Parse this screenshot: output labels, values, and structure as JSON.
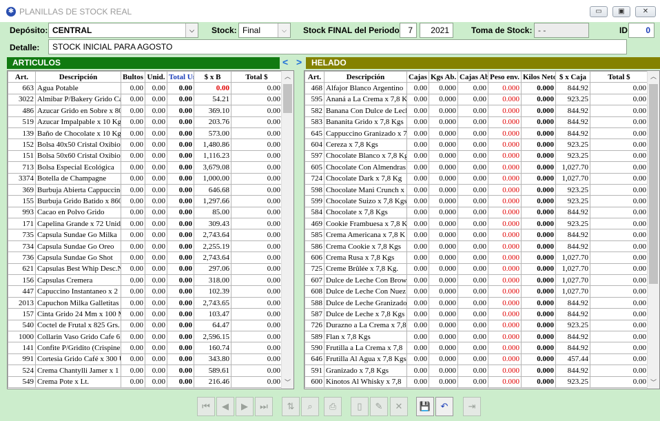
{
  "window": {
    "title": "PLANILLAS DE STOCK REAL"
  },
  "form": {
    "deposito_label": "Depósito:",
    "deposito_value": "CENTRAL",
    "stock_label": "Stock:",
    "stock_value": "Final",
    "periodo_label": "Stock FINAL del Periodo:",
    "month": "7",
    "year": "2021",
    "toma_label": "Toma de Stock:",
    "toma_value": "- -",
    "id_label": "ID",
    "id_value": "0",
    "detalle_label": "Detalle:",
    "detalle_value": "STOCK INICIAL PARA AGOSTO"
  },
  "sections": {
    "left": "ARTICULOS",
    "right": "HELADO",
    "arrow_left": "<",
    "arrow_right": ">"
  },
  "colors": {
    "section_left": "#117a11",
    "section_right": "#848200",
    "bg": "#ccedcc"
  },
  "left_table": {
    "headers": [
      "Art.",
      "Descripción",
      "Bultos",
      "Unid.",
      "Total Uni",
      "$ x B",
      "Total $"
    ],
    "rows": [
      [
        "663",
        "Agua Potable",
        "0.00",
        "0.00",
        "0.00",
        "0.00",
        "0.00"
      ],
      [
        "3022",
        "Almibar P/Bakery Grido Ca",
        "0.00",
        "0.00",
        "0.00",
        "54.21",
        "0.00"
      ],
      [
        "486",
        "Azucar Grido en Sobre x 80",
        "0.00",
        "0.00",
        "0.00",
        "369.10",
        "0.00"
      ],
      [
        "519",
        "Azucar Impalpable x 10 Kg",
        "0.00",
        "0.00",
        "0.00",
        "203.76",
        "0.00"
      ],
      [
        "139",
        "Baño de Chocolate x 10 Kg",
        "0.00",
        "0.00",
        "0.00",
        "573.00",
        "0.00"
      ],
      [
        "152",
        "Bolsa 40x50 Cristal Oxibio",
        "0.00",
        "0.00",
        "0.00",
        "1,480.86",
        "0.00"
      ],
      [
        "151",
        "Bolsa 50x60 Cristal Oxibio",
        "0.00",
        "0.00",
        "0.00",
        "1,116.23",
        "0.00"
      ],
      [
        "713",
        "Bolsa Especial Ecológica",
        "0.00",
        "0.00",
        "0.00",
        "3,679.08",
        "0.00"
      ],
      [
        "3374",
        "Botella de Champagne",
        "0.00",
        "0.00",
        "0.00",
        "1,000.00",
        "0.00"
      ],
      [
        "369",
        "Burbuja Abierta Cappuccino",
        "0.00",
        "0.00",
        "0.00",
        "646.68",
        "0.00"
      ],
      [
        "155",
        "Burbuja Grido Batido x 860",
        "0.00",
        "0.00",
        "0.00",
        "1,297.66",
        "0.00"
      ],
      [
        "993",
        "Cacao en Polvo Grido",
        "0.00",
        "0.00",
        "0.00",
        "85.00",
        "0.00"
      ],
      [
        "171",
        "Capelina Grande x 72 Unid",
        "0.00",
        "0.00",
        "0.00",
        "309.43",
        "0.00"
      ],
      [
        "735",
        "Capsula Sundae Go Milka",
        "0.00",
        "0.00",
        "0.00",
        "2,743.64",
        "0.00"
      ],
      [
        "734",
        "Capsula Sundae Go Oreo",
        "0.00",
        "0.00",
        "0.00",
        "2,255.19",
        "0.00"
      ],
      [
        "736",
        "Capsula Sundae Go Shot",
        "0.00",
        "0.00",
        "0.00",
        "2,743.64",
        "0.00"
      ],
      [
        "621",
        "Capsulas Best Whip Desc.N",
        "0.00",
        "0.00",
        "0.00",
        "297.06",
        "0.00"
      ],
      [
        "156",
        "Capsulas Cremera",
        "0.00",
        "0.00",
        "0.00",
        "318.00",
        "0.00"
      ],
      [
        "447",
        "Capuccino Instantaneo x 2",
        "0.00",
        "0.00",
        "0.00",
        "102.39",
        "0.00"
      ],
      [
        "2013",
        "Capuchon Milka Galletitas",
        "0.00",
        "0.00",
        "0.00",
        "2,743.65",
        "0.00"
      ],
      [
        "157",
        "Cinta Grido 24 Mm x 100 M",
        "0.00",
        "0.00",
        "0.00",
        "103.47",
        "0.00"
      ],
      [
        "540",
        "Coctel de Frutal x 825 Grs.",
        "0.00",
        "0.00",
        "0.00",
        "64.47",
        "0.00"
      ],
      [
        "1000",
        "Collarin Vaso Grido Cafe 6",
        "0.00",
        "0.00",
        "0.00",
        "2,596.15",
        "0.00"
      ],
      [
        "141",
        "Confite P/Gridito (Crispine",
        "0.00",
        "0.00",
        "0.00",
        "160.74",
        "0.00"
      ],
      [
        "991",
        "Cortesia Grido Café x 300 U",
        "0.00",
        "0.00",
        "0.00",
        "343.80",
        "0.00"
      ],
      [
        "524",
        "Crema Chantylli Jamer x 1",
        "0.00",
        "0.00",
        "0.00",
        "589.61",
        "0.00"
      ],
      [
        "549",
        "Crema Pote x Lt.",
        "0.00",
        "0.00",
        "0.00",
        "216.46",
        "0.00"
      ]
    ]
  },
  "right_table": {
    "headers": [
      "Art.",
      "Descripción",
      "Cajas",
      "Kgs Ab.",
      "Cajas Ab.",
      "Peso env.",
      "Kilos Netos",
      "$ x Caja",
      "Total $"
    ],
    "rows": [
      [
        "468",
        "Alfajor Blanco Argentino",
        "0.00",
        "0.000",
        "0.00",
        "0.000",
        "0.000",
        "844.92",
        "0.00"
      ],
      [
        "595",
        "Ananá a La Crema x 7,8 K",
        "0.00",
        "0.000",
        "0.00",
        "0.000",
        "0.000",
        "923.25",
        "0.00"
      ],
      [
        "582",
        "Banana Con Dulce de Lech",
        "0.00",
        "0.000",
        "0.00",
        "0.000",
        "0.000",
        "844.92",
        "0.00"
      ],
      [
        "583",
        "Bananita Grido x 7,8 Kgs",
        "0.00",
        "0.000",
        "0.00",
        "0.000",
        "0.000",
        "844.92",
        "0.00"
      ],
      [
        "645",
        "Cappuccino Granizado x 7",
        "0.00",
        "0.000",
        "0.00",
        "0.000",
        "0.000",
        "844.92",
        "0.00"
      ],
      [
        "604",
        "Cereza x 7,8 Kgs",
        "0.00",
        "0.000",
        "0.00",
        "0.000",
        "0.000",
        "923.25",
        "0.00"
      ],
      [
        "597",
        "Chocolate Blanco x 7,8 Kg",
        "0.00",
        "0.000",
        "0.00",
        "0.000",
        "0.000",
        "923.25",
        "0.00"
      ],
      [
        "605",
        "Chocolate Con Almendras",
        "0.00",
        "0.000",
        "0.00",
        "0.000",
        "0.000",
        "1,027.70",
        "0.00"
      ],
      [
        "724",
        "Chocolate Dark x 7,8 Kg",
        "0.00",
        "0.000",
        "0.00",
        "0.000",
        "0.000",
        "1,027.70",
        "0.00"
      ],
      [
        "598",
        "Chocolate Mani Crunch x",
        "0.00",
        "0.000",
        "0.00",
        "0.000",
        "0.000",
        "923.25",
        "0.00"
      ],
      [
        "599",
        "Chocolate Suizo x 7,8 Kgs",
        "0.00",
        "0.000",
        "0.00",
        "0.000",
        "0.000",
        "923.25",
        "0.00"
      ],
      [
        "584",
        "Chocolate x 7,8 Kgs",
        "0.00",
        "0.000",
        "0.00",
        "0.000",
        "0.000",
        "844.92",
        "0.00"
      ],
      [
        "469",
        "Cookie Frambuesa x 7,8 K",
        "0.00",
        "0.000",
        "0.00",
        "0.000",
        "0.000",
        "923.25",
        "0.00"
      ],
      [
        "585",
        "Crema Americana x 7,8 K",
        "0.00",
        "0.000",
        "0.00",
        "0.000",
        "0.000",
        "844.92",
        "0.00"
      ],
      [
        "586",
        "Crema Cookie x 7,8 Kgs",
        "0.00",
        "0.000",
        "0.00",
        "0.000",
        "0.000",
        "844.92",
        "0.00"
      ],
      [
        "606",
        "Crema Rusa x 7,8 Kgs",
        "0.00",
        "0.000",
        "0.00",
        "0.000",
        "0.000",
        "1,027.70",
        "0.00"
      ],
      [
        "725",
        "Creme Brûlée x 7,8 Kg.",
        "0.00",
        "0.000",
        "0.00",
        "0.000",
        "0.000",
        "1,027.70",
        "0.00"
      ],
      [
        "607",
        "Dulce de Leche Con Brow",
        "0.00",
        "0.000",
        "0.00",
        "0.000",
        "0.000",
        "1,027.70",
        "0.00"
      ],
      [
        "608",
        "Dulce de Leche Con Nuez",
        "0.00",
        "0.000",
        "0.00",
        "0.000",
        "0.000",
        "1,027.70",
        "0.00"
      ],
      [
        "588",
        "Dulce de Leche Granizado",
        "0.00",
        "0.000",
        "0.00",
        "0.000",
        "0.000",
        "844.92",
        "0.00"
      ],
      [
        "587",
        "Dulce de Leche x 7,8 Kgs",
        "0.00",
        "0.000",
        "0.00",
        "0.000",
        "0.000",
        "844.92",
        "0.00"
      ],
      [
        "726",
        "Durazno a La Crema x 7,8",
        "0.00",
        "0.000",
        "0.00",
        "0.000",
        "0.000",
        "923.25",
        "0.00"
      ],
      [
        "589",
        "Flan x 7,8 Kgs",
        "0.00",
        "0.000",
        "0.00",
        "0.000",
        "0.000",
        "844.92",
        "0.00"
      ],
      [
        "590",
        "Frutilla a La Crema x 7,8",
        "0.00",
        "0.000",
        "0.00",
        "0.000",
        "0.000",
        "844.92",
        "0.00"
      ],
      [
        "646",
        "Frutilla Al Agua x 7,8 Kgs",
        "0.00",
        "0.000",
        "0.00",
        "0.000",
        "0.000",
        "457.44",
        "0.00"
      ],
      [
        "591",
        "Granizado x 7,8 Kgs",
        "0.00",
        "0.000",
        "0.00",
        "0.000",
        "0.000",
        "844.92",
        "0.00"
      ],
      [
        "600",
        "Kinotos Al Whisky x 7,8",
        "0.00",
        "0.000",
        "0.00",
        "0.000",
        "0.000",
        "923.25",
        "0.00"
      ]
    ]
  },
  "toolbar": [
    {
      "name": "first-record-button",
      "icon": "⏮",
      "enabled": false
    },
    {
      "name": "prev-record-button",
      "icon": "◀",
      "enabled": false
    },
    {
      "name": "next-record-button",
      "icon": "▶",
      "enabled": false
    },
    {
      "name": "last-record-button",
      "icon": "⏭",
      "enabled": false
    },
    {
      "name": "sort-button",
      "icon": "⇅",
      "enabled": false
    },
    {
      "name": "find-button",
      "icon": "⌕",
      "enabled": false
    },
    {
      "name": "print-button",
      "icon": "⎙",
      "enabled": false
    },
    {
      "name": "new-button",
      "icon": "▯",
      "enabled": false
    },
    {
      "name": "edit-button",
      "icon": "✎",
      "enabled": false
    },
    {
      "name": "delete-button",
      "icon": "✕",
      "enabled": false
    },
    {
      "name": "save-button",
      "icon": "💾",
      "enabled": true
    },
    {
      "name": "undo-button",
      "icon": "↶",
      "enabled": true
    },
    {
      "name": "exit-button",
      "icon": "⇥",
      "enabled": false
    }
  ]
}
